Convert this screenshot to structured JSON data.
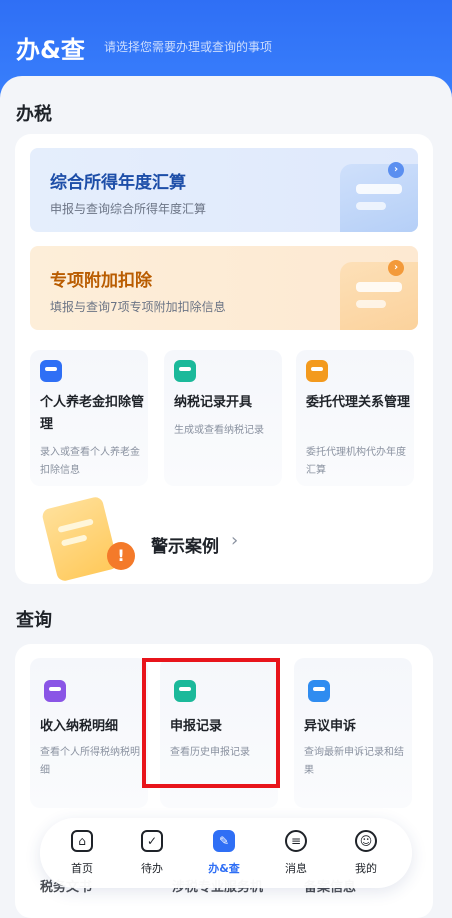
{
  "header": {
    "title": "办&查",
    "subtitle": "请选择您需要办理或查询的事项"
  },
  "tax_section": {
    "title": "办税",
    "banners": [
      {
        "title": "综合所得年度汇算",
        "desc": "申报与查询综合所得年度汇算",
        "icon": "calculator-icon",
        "color": "#1d4ea8"
      },
      {
        "title": "专项附加扣除",
        "desc": "填报与查询7项专项附加扣除信息",
        "icon": "document-edit-icon",
        "color": "#b95c00"
      }
    ],
    "tiles": [
      {
        "title": "个人养老金扣除管理",
        "desc": "录入或查看个人养老金扣除信息",
        "icon": "pension-card-icon",
        "color": "#2f6ff5"
      },
      {
        "title": "纳税记录开具",
        "desc": "生成或查看纳税记录",
        "icon": "tax-record-icon",
        "color": "#1bb99a"
      },
      {
        "title": "委托代理关系管理",
        "desc": "委托代理机构代办年度汇算",
        "icon": "agent-icon",
        "color": "#f39a1e"
      }
    ],
    "warning": {
      "label": "警示案例",
      "chevron": "›"
    }
  },
  "query_section": {
    "title": "查询",
    "tiles": [
      {
        "title": "收入纳税明细",
        "desc": "查看个人所得税纳税明细",
        "icon": "income-detail-icon",
        "color": "#8a55e6"
      },
      {
        "title": "申报记录",
        "desc": "查看历史申报记录",
        "icon": "declaration-record-icon",
        "color": "#1bb99a"
      },
      {
        "title": "异议申诉",
        "desc": "查询最新申诉记录和结果",
        "icon": "appeal-icon",
        "color": "#2f8cf0"
      }
    ],
    "peek_labels": [
      "税务文书",
      "涉税专业服务机",
      "备案信息"
    ]
  },
  "bottom_nav": [
    {
      "label": "首页",
      "icon": "home-icon",
      "glyph": "⌂",
      "active": false
    },
    {
      "label": "待办",
      "icon": "calendar-check-icon",
      "glyph": "✓",
      "active": false
    },
    {
      "label": "办&查",
      "icon": "handle-query-icon",
      "glyph": "✎",
      "active": true
    },
    {
      "label": "消息",
      "icon": "message-icon",
      "glyph": "≡",
      "active": false
    },
    {
      "label": "我的",
      "icon": "profile-icon",
      "glyph": "☺",
      "active": false
    }
  ],
  "colors": {
    "primary": "#2f6ff5",
    "highlight": "#e8141b"
  }
}
